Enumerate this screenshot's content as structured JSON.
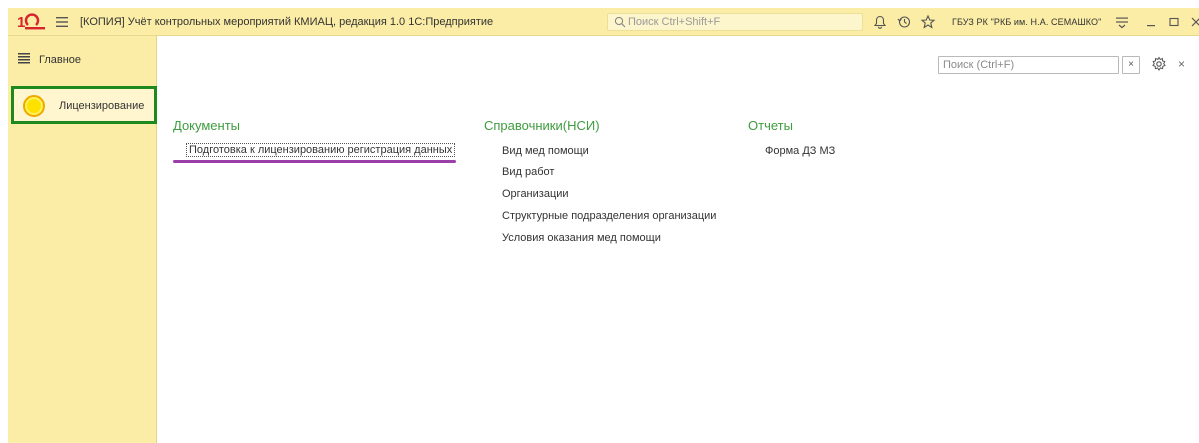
{
  "titlebar": {
    "logo": "1C-logo",
    "title": "[КОПИЯ] Учёт контрольных мероприятий КМИАЦ, редакция 1.0 1С:Предприятие",
    "search_placeholder": "Поиск Ctrl+Shift+F",
    "org": "ГБУЗ РК \"РКБ им. Н.А. СЕМАШКО\""
  },
  "sidebar": {
    "items": [
      {
        "label": "Главное",
        "icon": "hamburger-icon"
      },
      {
        "label": "Лицензирование",
        "icon": "yellow-circle-icon"
      }
    ]
  },
  "content": {
    "search_placeholder": "Поиск (Ctrl+F)",
    "clear_label": "×",
    "close_label": "×",
    "sections": {
      "documents": {
        "title": "Документы",
        "items": [
          "Подготовка к лицензированию регистрация данных"
        ]
      },
      "references": {
        "title": "Справочники(НСИ)",
        "items": [
          "Вид мед помощи",
          "Вид работ",
          "Организации",
          "Структурные подразделения организации",
          "Условия оказания мед помощи"
        ]
      },
      "reports": {
        "title": "Отчеты",
        "items": [
          "Форма ДЗ МЗ"
        ]
      }
    }
  },
  "colors": {
    "panel": "#fbeda6",
    "section_title": "#3f9c3f",
    "active_border": "#1e8a1e",
    "highlight_underline": "#9b3fa8"
  }
}
